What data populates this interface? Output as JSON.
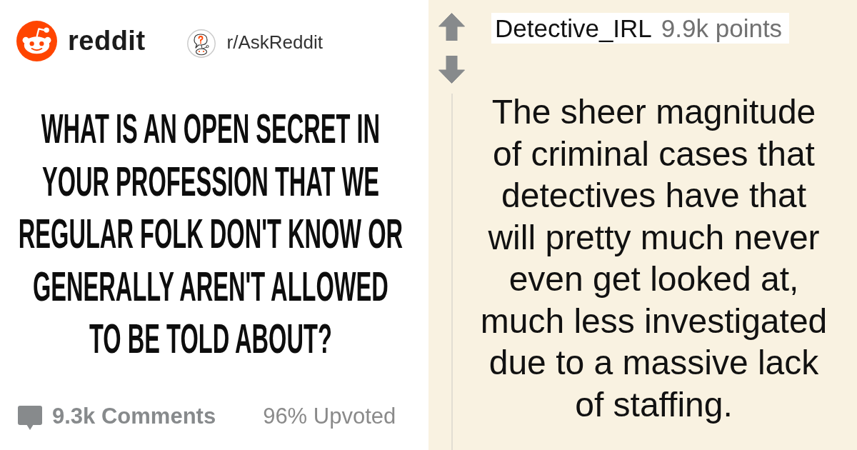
{
  "post": {
    "site_name": "reddit",
    "subreddit": "r/AskReddit",
    "title": "WHAT IS AN OPEN SECRET IN\nYOUR PROFESSION THAT WE\nREGULAR FOLK DON'T KNOW OR\nGENERALLY AREN'T ALLOWED\nTO BE TOLD ABOUT?",
    "comments": "9.3k Comments",
    "upvoted": "96% Upvoted"
  },
  "comment": {
    "author": "Detective_IRL",
    "points": "9.9k points",
    "body": "The sheer magnitude of criminal cases that detectives have that will pretty much never even get looked at, much less investigated due to a massive lack of staffing."
  }
}
